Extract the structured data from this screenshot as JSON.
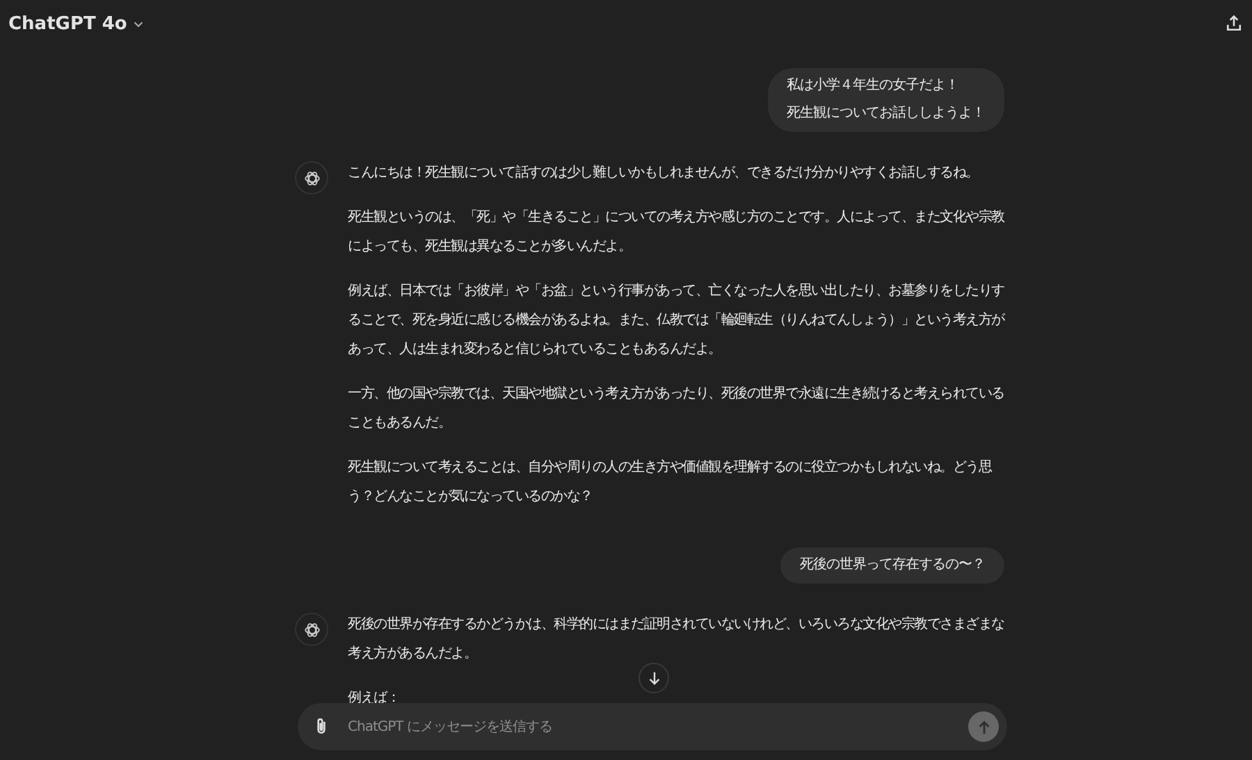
{
  "header": {
    "model": "ChatGPT 4o"
  },
  "messages": [
    {
      "kind": "user",
      "paragraphs": [
        "私は小学４年生の女子だよ！",
        "死生観についてお話ししようよ！"
      ]
    },
    {
      "kind": "assistant",
      "paragraphs": [
        "こんにちは！死生観について話すのは少し難しいかもしれませんが、できるだけ分かりやすくお話しするね。",
        "死生観というのは、「死」や「生きること」についての考え方や感じ方のことです。人によって、また文化や宗教によっても、死生観は異なることが多いんだよ。",
        "例えば、日本では「お彼岸」や「お盆」という行事があって、亡くなった人を思い出したり、お墓参りをしたりすることで、死を身近に感じる機会があるよね。また、仏教では「輪廻転生（りんねてんしょう）」という考え方があって、人は生まれ変わると信じられていることもあるんだよ。",
        "一方、他の国や宗教では、天国や地獄という考え方があったり、死後の世界で永遠に生き続けると考えられていることもあるんだ。",
        "死生観について考えることは、自分や周りの人の生き方や価値観を理解するのに役立つかもしれないね。どう思う？どんなことが気になっているのかな？"
      ]
    },
    {
      "kind": "user",
      "paragraphs": [
        "死後の世界って存在するの〜？"
      ]
    },
    {
      "kind": "assistant",
      "paragraphs": [
        "死後の世界が存在するかどうかは、科学的にはまだ証明されていないけれど、いろいろな文化や宗教でさまざまな考え方があるんだよ。",
        "例えば："
      ]
    }
  ],
  "composer": {
    "placeholder": "ChatGPT にメッセージを送信する"
  }
}
